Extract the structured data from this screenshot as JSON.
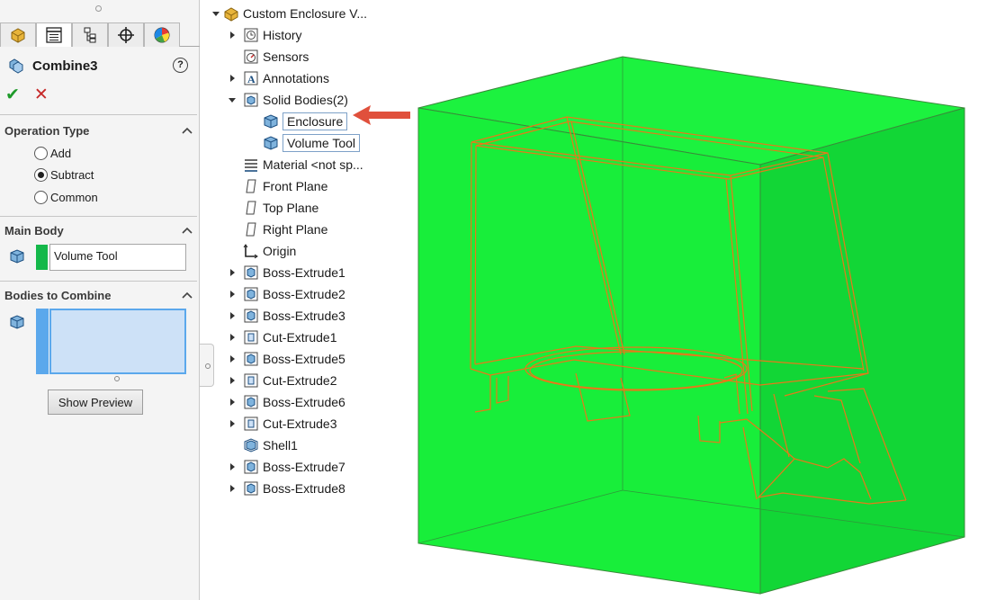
{
  "property_manager": {
    "tabs": [
      "feature-manager-icon",
      "property-manager-icon",
      "configuration-manager-icon",
      "dimxpert-icon",
      "display-manager-icon"
    ],
    "feature_name": "Combine3",
    "help_symbol": "?",
    "ok_symbol": "✔",
    "cancel_symbol": "✕",
    "operation_type": {
      "title": "Operation Type",
      "options": [
        {
          "label": "Add",
          "selected": false
        },
        {
          "label": "Subtract",
          "selected": true
        },
        {
          "label": "Common",
          "selected": false
        }
      ]
    },
    "main_body": {
      "title": "Main Body",
      "value": "Volume Tool",
      "swatch_color": "#14b84a"
    },
    "bodies_to_combine": {
      "title": "Bodies to Combine",
      "items": [],
      "highlight_color": "#5ba8ec"
    },
    "show_preview_label": "Show Preview"
  },
  "feature_tree": {
    "root": "Custom Enclosure V...",
    "nodes": [
      {
        "label": "History",
        "toggle": "collapsed",
        "icon": "history-icon"
      },
      {
        "label": "Sensors",
        "toggle": "none",
        "icon": "sensor-icon"
      },
      {
        "label": "Annotations",
        "toggle": "collapsed",
        "icon": "annotation-icon"
      },
      {
        "label": "Solid Bodies(2)",
        "toggle": "expanded",
        "icon": "solid-bodies-folder-icon"
      },
      {
        "label": "Enclosure",
        "toggle": "none",
        "icon": "solid-body-icon",
        "child": true,
        "boxed": true
      },
      {
        "label": "Volume Tool",
        "toggle": "none",
        "icon": "solid-body-icon",
        "child": true,
        "boxed": true,
        "selected": true
      },
      {
        "label": "Material  <not sp...",
        "toggle": "none",
        "icon": "material-icon"
      },
      {
        "label": "Front Plane",
        "toggle": "none",
        "icon": "plane-icon"
      },
      {
        "label": "Top Plane",
        "toggle": "none",
        "icon": "plane-icon"
      },
      {
        "label": "Right Plane",
        "toggle": "none",
        "icon": "plane-icon"
      },
      {
        "label": "Origin",
        "toggle": "none",
        "icon": "origin-icon"
      },
      {
        "label": "Boss-Extrude1",
        "toggle": "collapsed",
        "icon": "boss-extrude-icon"
      },
      {
        "label": "Boss-Extrude2",
        "toggle": "collapsed",
        "icon": "boss-extrude-icon"
      },
      {
        "label": "Boss-Extrude3",
        "toggle": "collapsed",
        "icon": "boss-extrude-icon"
      },
      {
        "label": "Cut-Extrude1",
        "toggle": "collapsed",
        "icon": "cut-extrude-icon"
      },
      {
        "label": "Boss-Extrude5",
        "toggle": "collapsed",
        "icon": "boss-extrude-icon"
      },
      {
        "label": "Cut-Extrude2",
        "toggle": "collapsed",
        "icon": "cut-extrude-icon"
      },
      {
        "label": "Boss-Extrude6",
        "toggle": "collapsed",
        "icon": "boss-extrude-icon"
      },
      {
        "label": "Cut-Extrude3",
        "toggle": "collapsed",
        "icon": "cut-extrude-icon"
      },
      {
        "label": "Shell1",
        "toggle": "none",
        "icon": "shell-icon"
      },
      {
        "label": "Boss-Extrude7",
        "toggle": "collapsed",
        "icon": "boss-extrude-icon"
      },
      {
        "label": "Boss-Extrude8",
        "toggle": "collapsed",
        "icon": "boss-extrude-icon"
      }
    ]
  },
  "viewport": {
    "volume_tool_color": "#16f03c",
    "enclosure_edge_color": "#e8781a",
    "callout_arrow_color": "#e0503c"
  }
}
